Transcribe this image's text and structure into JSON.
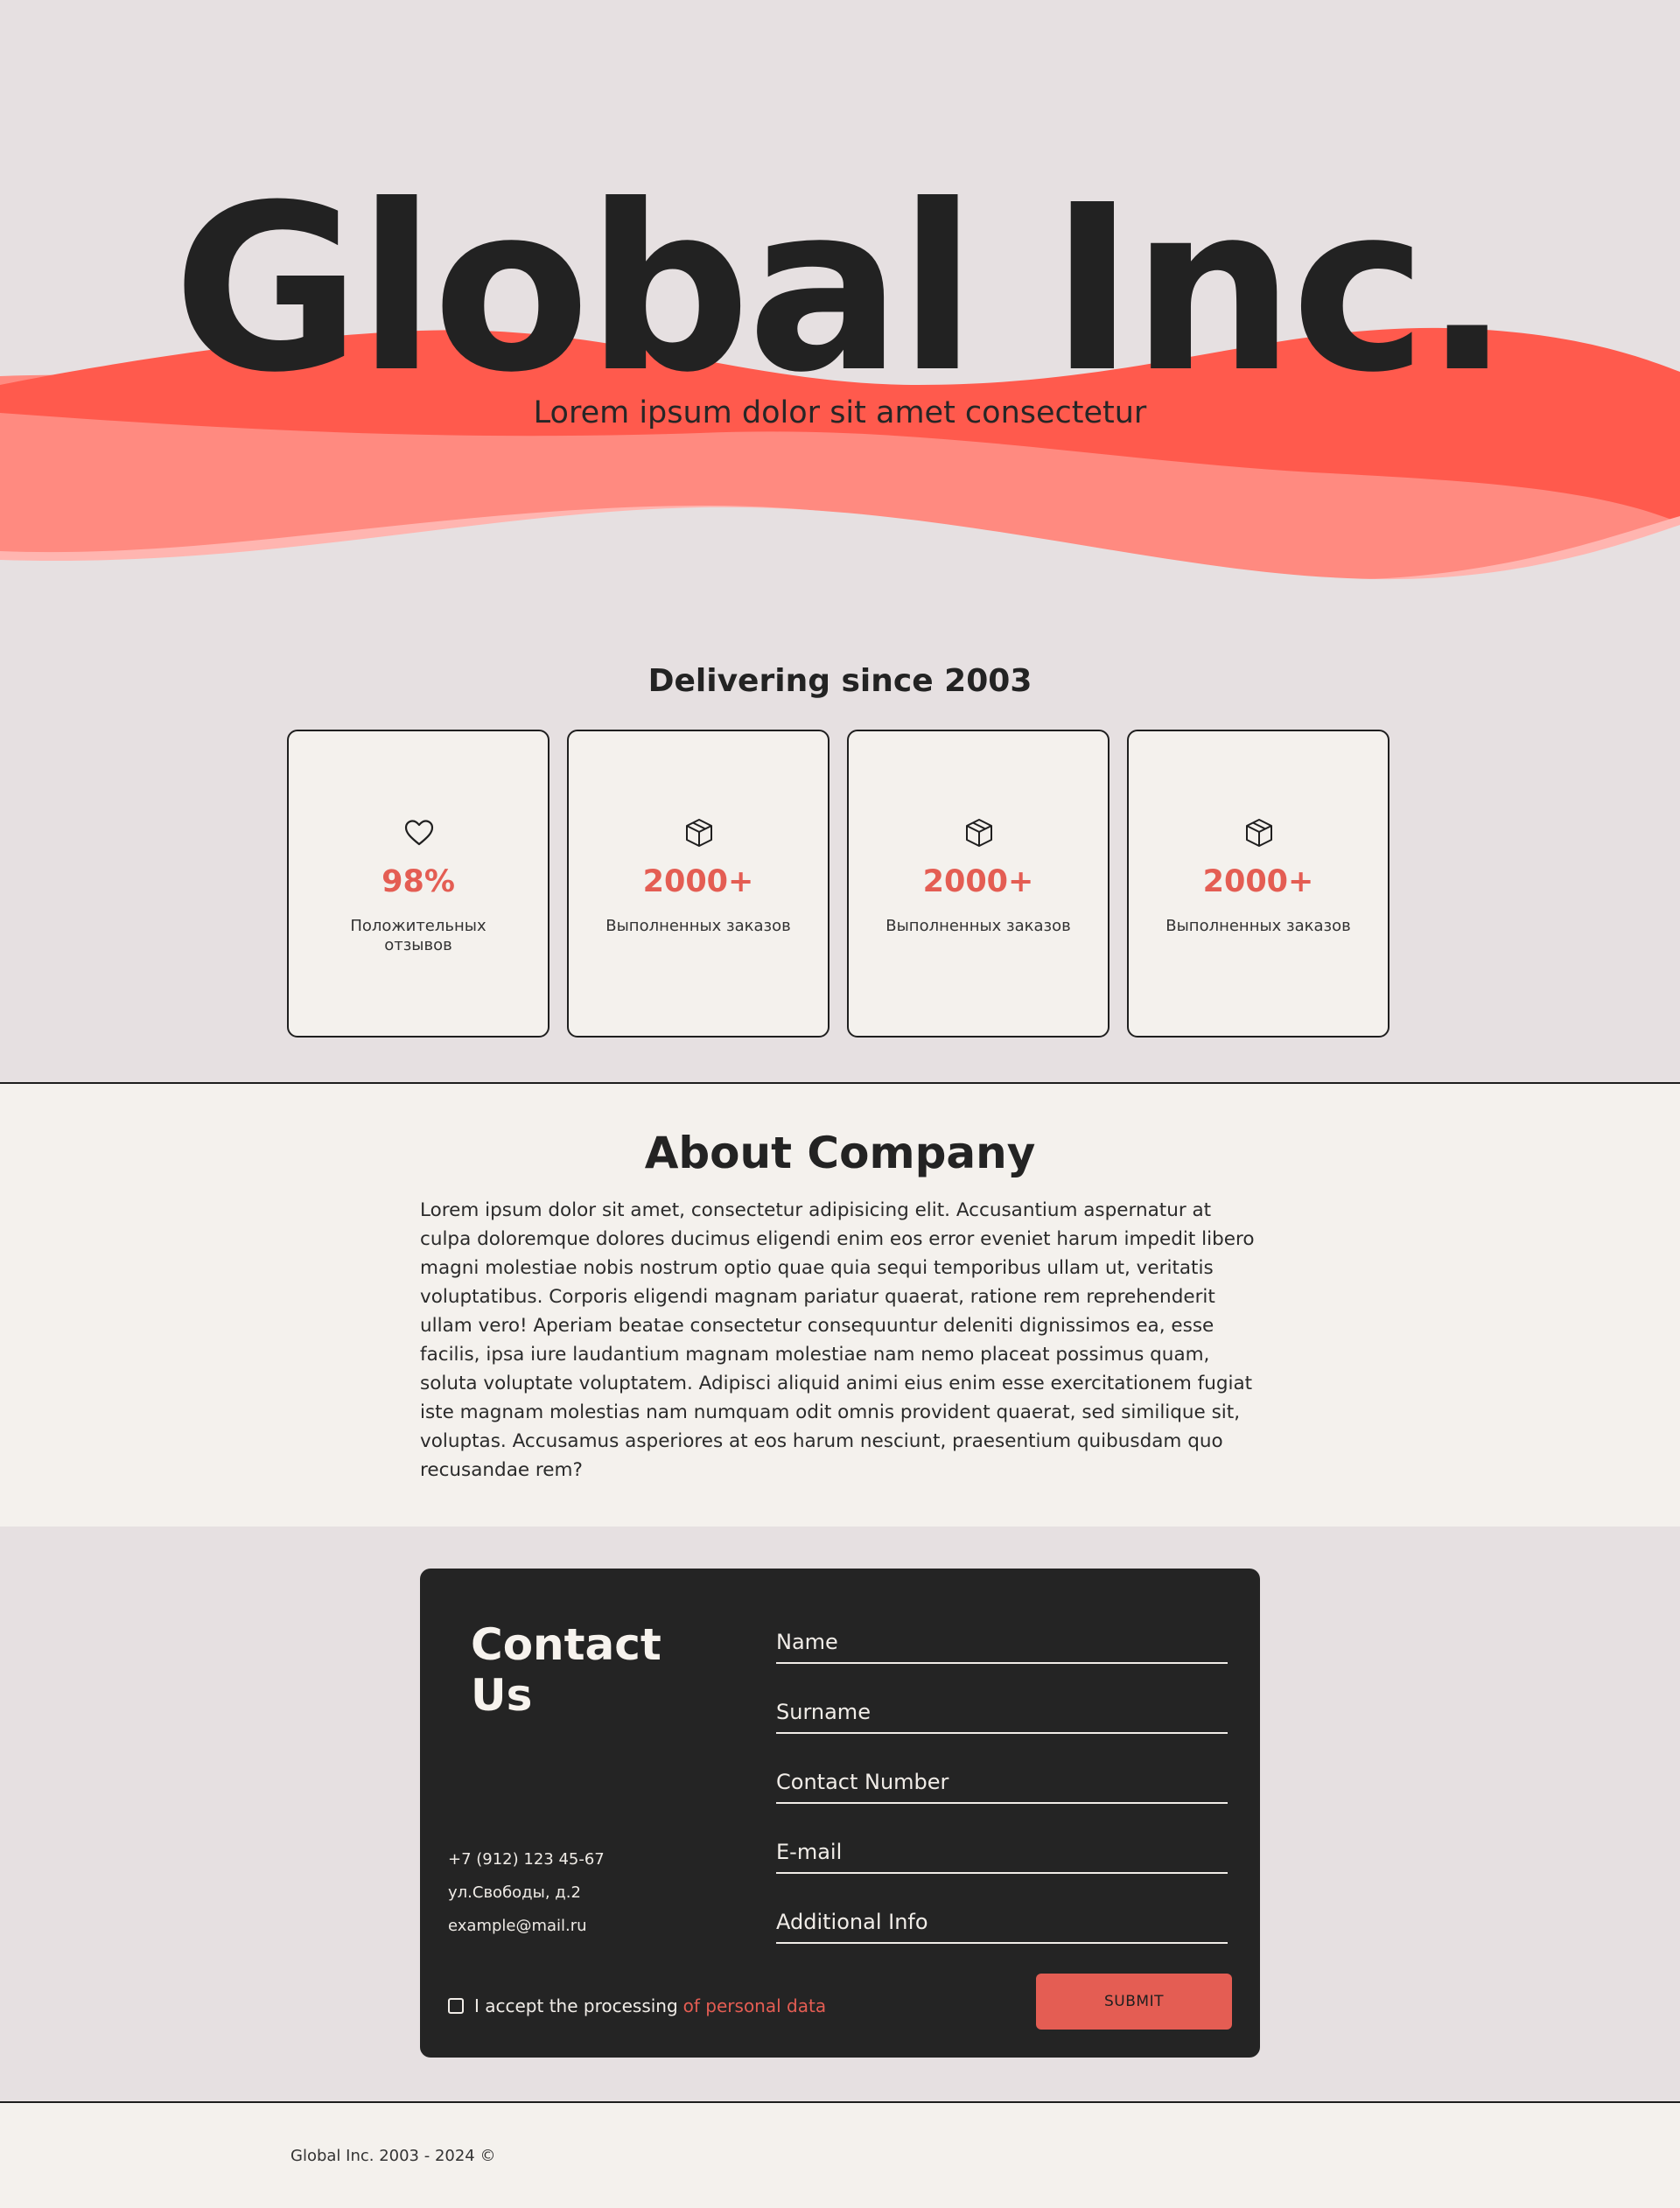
{
  "hero": {
    "title": "Global Inc.",
    "subtitle": "Lorem ipsum dolor sit amet consectetur"
  },
  "stats": {
    "heading": "Delivering since 2003",
    "cards": [
      {
        "icon": "heart-icon",
        "value": "98%",
        "label": "Положительных отзывов"
      },
      {
        "icon": "box-icon",
        "value": "2000+",
        "label": "Выполненных заказов"
      },
      {
        "icon": "box-icon",
        "value": "2000+",
        "label": "Выполненных заказов"
      },
      {
        "icon": "box-icon",
        "value": "2000+",
        "label": "Выполненных заказов"
      }
    ]
  },
  "about": {
    "title": "About Company",
    "text": "Lorem ipsum dolor sit amet, consectetur adipisicing elit. Accusantium aspernatur at culpa doloremque dolores ducimus eligendi enim eos error eveniet harum impedit libero magni molestiae nobis nostrum optio quae quia sequi temporibus ullam ut, veritatis voluptatibus. Corporis eligendi magnam pariatur quaerat, ratione rem reprehenderit ullam vero! Aperiam beatae consectetur consequuntur deleniti dignissimos ea, esse facilis, ipsa iure laudantium magnam molestiae nam nemo placeat possimus quam, soluta voluptate voluptatem. Adipisci aliquid animi eius enim esse exercitationem fugiat iste magnam molestias nam numquam odit omnis provident quaerat, sed similique sit, voluptas. Accusamus asperiores at eos harum nesciunt, praesentium quibusdam quo recusandae rem?"
  },
  "contact": {
    "title": "Contact Us",
    "phone": "+7 (912) 123 45-67",
    "address": "ул.Свободы, д.2",
    "email": "example@mail.ru",
    "fields": {
      "name": "Name",
      "surname": "Surname",
      "contact_number": "Contact Number",
      "email": "E-mail",
      "additional": "Additional Info"
    },
    "consent_text": "I accept the processing",
    "consent_link": "of personal data",
    "submit_label": "SUBMIT"
  },
  "footer": {
    "text": "Global Inc. 2003 - 2024 ©"
  },
  "colors": {
    "accent": "#e45d53",
    "wave_dark": "#ff5a4d",
    "wave_mid": "#ff8a80",
    "wave_light": "#ffb5b0",
    "background": "#e6e0e1",
    "panel": "#f4f1ed",
    "dark": "#242424"
  }
}
